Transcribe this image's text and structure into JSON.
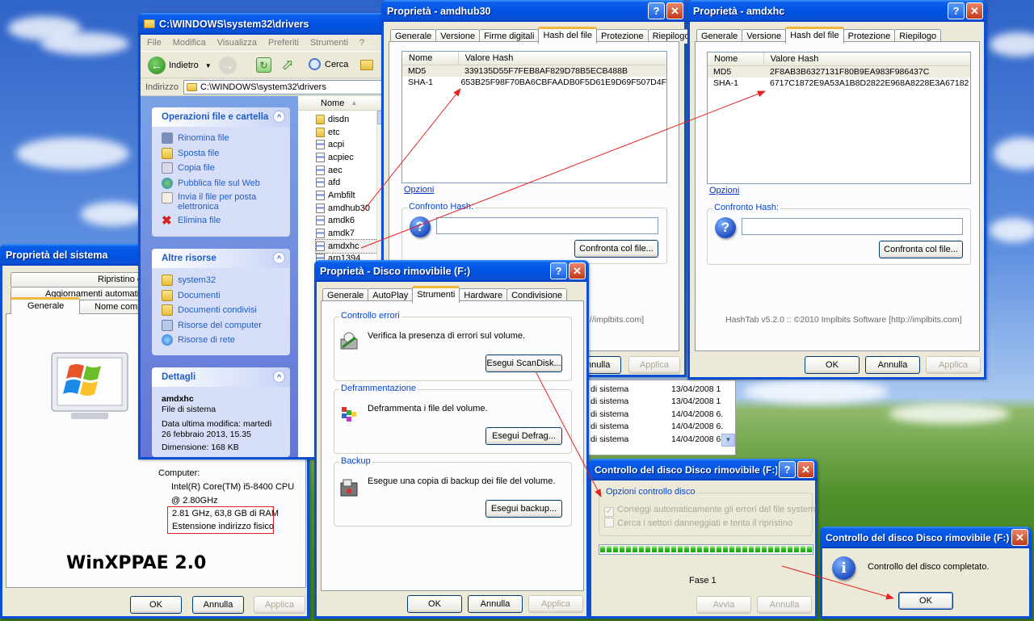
{
  "sysprop": {
    "title": "Proprietà del sistema",
    "tabs": [
      "Ripristino configurazione di sistema",
      "Aggiornamenti automatici",
      "Generale",
      "Nome computer"
    ],
    "computer_label": "Computer:",
    "cpu_line1": "Intel(R) Core(TM) i5-8400 CPU",
    "cpu_line2": "@ 2.80GHz",
    "cpu_line3": "2.81 GHz, 63,8 GB di RAM",
    "cpu_line4": "Estensione indirizzo fisico",
    "watermark": "WinXPPAE 2.0",
    "ok": "OK",
    "cancel": "Annulla",
    "apply": "Applica"
  },
  "explorer": {
    "title": "C:\\WINDOWS\\system32\\drivers",
    "menu": [
      "File",
      "Modifica",
      "Visualizza",
      "Preferiti",
      "Strumenti",
      "?"
    ],
    "back_label": "Indietro",
    "search_label": "Cerca",
    "address_label": "Indirizzo",
    "address_value": "C:\\WINDOWS\\system32\\drivers",
    "tasks_title": "Operazioni file e cartella",
    "tasks": [
      "Rinomina file",
      "Sposta file",
      "Copia file",
      "Pubblica file sul Web",
      "Invia il file per posta elettronica",
      "Elimina file"
    ],
    "other_title": "Altre risorse",
    "other": [
      "system32",
      "Documenti",
      "Documenti condivisi",
      "Risorse del computer",
      "Risorse di rete"
    ],
    "details_title": "Dettagli",
    "details_name": "amdxhc",
    "details_type": "File di sistema",
    "details_date": "Data ultima modifica: martedì 26 febbraio 2013, 15.35",
    "details_size": "Dimensione: 168 KB",
    "col_name": "Nome",
    "files": [
      "disdn",
      "etc",
      "acpi",
      "acpiec",
      "aec",
      "afd",
      "Ambfilt",
      "amdhub30",
      "amdk6",
      "amdk7",
      "amdxhc",
      "arp1394"
    ],
    "behind_rows": [
      {
        "type": "di sistema",
        "date": "13/04/2008 1"
      },
      {
        "type": "di sistema",
        "date": "13/04/2008 1"
      },
      {
        "type": "di sistema",
        "date": "14/04/2008 6."
      },
      {
        "type": "di sistema",
        "date": "14/04/2008 6."
      },
      {
        "type": "di sistema",
        "date": "14/04/2008 6."
      }
    ]
  },
  "hub": {
    "title": "Proprietà - amdhub30",
    "tabs": [
      "Generale",
      "Versione",
      "Firme digitali",
      "Hash del file",
      "Protezione",
      "Riepilogo"
    ],
    "col_name": "Nome",
    "col_value": "Valore Hash",
    "rows": [
      {
        "name": "MD5",
        "value": "339135D55F7FEB8AF829D78B5ECB488B"
      },
      {
        "name": "SHA-1",
        "value": "653B25F98F70BA6CBFAADB0F5D61E9D69F507D4F"
      }
    ],
    "options": "Opzioni",
    "compare_label": "Confronto Hash:",
    "compare_btn": "Confronta col file...",
    "credit": "://implbits.com]",
    "cancel": "Annulla",
    "apply": "Applica"
  },
  "xhc": {
    "title": "Proprietà - amdxhc",
    "tabs": [
      "Generale",
      "Versione",
      "Hash del file",
      "Protezione",
      "Riepilogo"
    ],
    "col_name": "Nome",
    "col_value": "Valore Hash",
    "rows": [
      {
        "name": "MD5",
        "value": "2F8AB3B6327131F80B9EA983F986437C"
      },
      {
        "name": "SHA-1",
        "value": "6717C1872E9A53A1B8D2822E968A8228E3A67182"
      }
    ],
    "options": "Opzioni",
    "compare_label": "Confronto Hash:",
    "compare_btn": "Confronta col file...",
    "credit": "HashTab v5.2.0 :: ©2010 Implbits Software [http://implbits.com]",
    "ok": "OK",
    "cancel": "Annulla",
    "apply": "Applica"
  },
  "disk": {
    "title": "Proprietà - Disco rimovibile (F:)",
    "tabs": [
      "Generale",
      "AutoPlay",
      "Strumenti",
      "Hardware",
      "Condivisione"
    ],
    "err_title": "Controllo errori",
    "err_text": "Verifica la presenza di errori sul volume.",
    "err_btn": "Esegui ScanDisk...",
    "defrag_title": "Deframmentazione",
    "defrag_text": "Deframmenta i file del volume.",
    "defrag_btn": "Esegui Defrag...",
    "backup_title": "Backup",
    "backup_text": "Esegue una copia di backup dei file del volume.",
    "backup_btn": "Esegui backup...",
    "ok": "OK",
    "cancel": "Annulla",
    "apply": "Applica"
  },
  "check": {
    "title": "Controllo del disco Disco rimovibile (F:)",
    "group": "Opzioni controllo disco",
    "opt1": "Correggi automaticamente gli errori del file system",
    "opt2": "Cerca i settori danneggiati e tenta il ripristino",
    "progress": 1.0,
    "phase": "Fase 1",
    "start": "Avvia",
    "cancel": "Annulla"
  },
  "done": {
    "title": "Controllo del disco Disco rimovibile (F:)",
    "message": "Controllo del disco completato.",
    "ok": "OK"
  },
  "colors": {
    "accent": "#0054e3",
    "annotation": "#e8201e"
  }
}
